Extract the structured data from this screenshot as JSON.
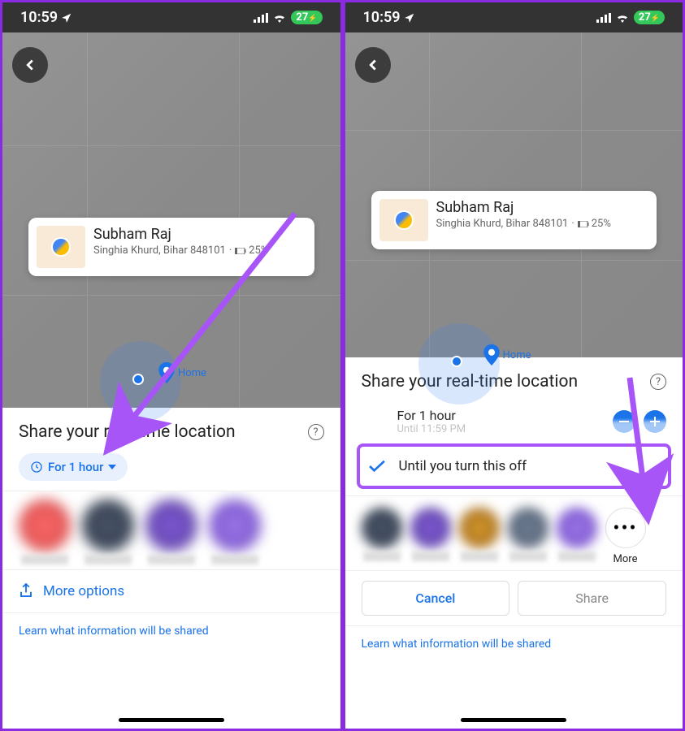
{
  "status_bar": {
    "time": "10:59",
    "battery_text": "27"
  },
  "info_card": {
    "name": "Subham Raj",
    "address": "Singhia Khurd, Bihar 848101",
    "battery_percent": "25%"
  },
  "home_pin": {
    "label": "Home"
  },
  "sheet": {
    "title": "Share your real-time location",
    "duration_chip": "For 1 hour",
    "duration_main": "For 1 hour",
    "duration_sub": "Until 11:59 PM",
    "option_until_off": "Until you turn this off",
    "more_options": "More options",
    "more_label": "More",
    "cancel": "Cancel",
    "share": "Share",
    "learn_link": "Learn what information will be shared"
  },
  "colors": {
    "accent": "#1a73e8",
    "annotation": "#a855f7",
    "battery_green": "#34c759"
  }
}
